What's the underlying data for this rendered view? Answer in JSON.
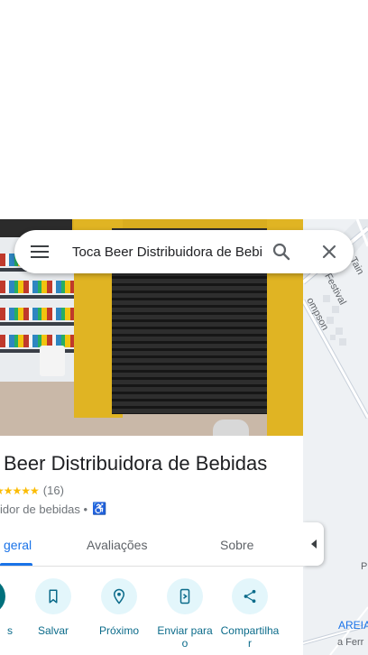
{
  "search": {
    "value": "Toca Beer Distribuidora de Bebidas",
    "menu_icon": "menu-icon",
    "search_icon": "search-icon",
    "close_icon": "close-icon"
  },
  "place": {
    "title": "Beer Distribuidora de Bebidas",
    "stars": "★★★★★",
    "rating_stars": 5,
    "reviews": "(16)",
    "category": "idor de bebidas •",
    "accessibility_icon": "wheelchair-icon"
  },
  "tabs": [
    {
      "label": "geral",
      "active": true
    },
    {
      "label": "Avaliações",
      "active": false
    },
    {
      "label": "Sobre",
      "active": false
    }
  ],
  "actions": [
    {
      "label": "s",
      "icon": "directions-icon"
    },
    {
      "label": "Salvar",
      "icon": "bookmark-icon"
    },
    {
      "label": "Próximo",
      "icon": "nearby-icon"
    },
    {
      "label": "Enviar para o",
      "icon": "send-to-phone-icon"
    },
    {
      "label": "Compartilha r",
      "icon": "share-icon"
    }
  ],
  "map": {
    "labels": [
      "Festival",
      "Tain",
      "ompson",
      "AREIA",
      "P",
      "a Ferr"
    ]
  },
  "colors": {
    "accent": "#1a73e8",
    "action_circle": "#e3f6fb",
    "action_text": "#0b6b8a",
    "star": "#fbbc04",
    "map_bg": "#eef1f4"
  }
}
